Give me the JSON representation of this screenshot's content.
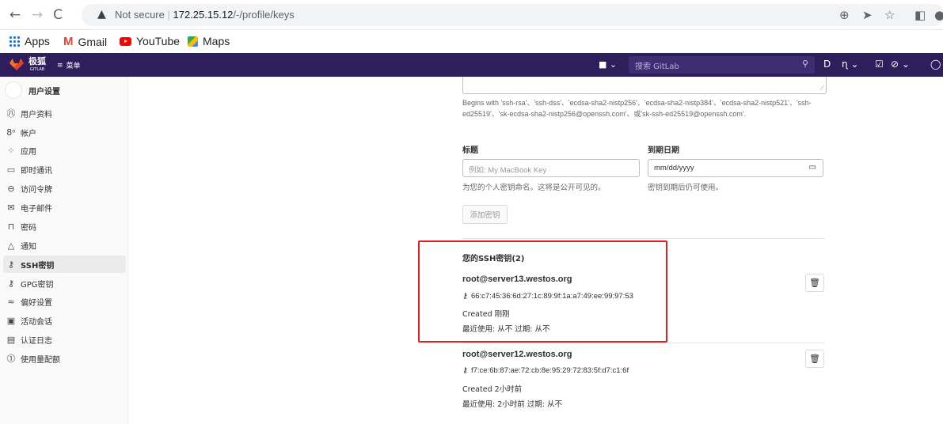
{
  "browser": {
    "warning": "Not secure",
    "url_host": "172.25.15.12",
    "url_path": "/-/profile/keys"
  },
  "bookmarks": [
    {
      "label": "Apps",
      "icon": "apps-grid-icon"
    },
    {
      "label": "Gmail",
      "icon": "gmail-icon"
    },
    {
      "label": "YouTube",
      "icon": "youtube-icon"
    },
    {
      "label": "Maps",
      "icon": "maps-icon"
    }
  ],
  "gitlab": {
    "brand": "极狐",
    "brand_sub": "GITLAB",
    "menu": "菜单",
    "search_placeholder": "搜索 GitLab"
  },
  "sidebar": {
    "title": "用户设置",
    "items": [
      {
        "label": "用户资料",
        "icon": "profile-icon"
      },
      {
        "label": "帐户",
        "icon": "account-icon"
      },
      {
        "label": "应用",
        "icon": "applications-icon"
      },
      {
        "label": "即时通讯",
        "icon": "chat-icon"
      },
      {
        "label": "访问令牌",
        "icon": "token-icon"
      },
      {
        "label": "电子邮件",
        "icon": "email-icon"
      },
      {
        "label": "密码",
        "icon": "lock-icon"
      },
      {
        "label": "通知",
        "icon": "bell-icon"
      },
      {
        "label": "SSH密钥",
        "icon": "key-icon",
        "active": true
      },
      {
        "label": "GPG密钥",
        "icon": "key-icon"
      },
      {
        "label": "偏好设置",
        "icon": "preferences-icon"
      },
      {
        "label": "活动会话",
        "icon": "sessions-icon"
      },
      {
        "label": "认证日志",
        "icon": "log-icon"
      },
      {
        "label": "使用量配额",
        "icon": "quota-icon"
      }
    ]
  },
  "form": {
    "key_help": "Begins with 'ssh-rsa'、'ssh-dss'、'ecdsa-sha2-nistp256'、'ecdsa-sha2-nistp384'、'ecdsa-sha2-nistp521'、'ssh-ed25519'、'sk-ecdsa-sha2-nistp256@openssh.com'、或'sk-ssh-ed25519@openssh.com'.",
    "title_label": "标题",
    "title_placeholder": "例如: My MacBook Key",
    "title_help": "为您的个人密钥命名。这将是公开可见的。",
    "expiry_label": "到期日期",
    "expiry_value": "mm/dd/yyyy",
    "expiry_help": "密钥到期后仍可使用。",
    "add_button": "添加密钥"
  },
  "keys_section": {
    "title": "您的SSH密钥(2)",
    "keys": [
      {
        "name": "root@server13.westos.org",
        "fingerprint": "66:c7:45:36:6d:27:1c:89:9f:1a:a7:49:ee:99:97:53",
        "created": "Created 刚刚",
        "usage": "最近使用: 从不  过期: 从不"
      },
      {
        "name": "root@server12.westos.org",
        "fingerprint": "f7:ce:6b:87:ae:72:cb:8e:95:29:72:83:5f:d7:c1:6f",
        "created": "Created 2小时前",
        "usage": "最近使用: 2小时前  过期: 从不"
      }
    ]
  },
  "colors": {
    "gitlab_topbar": "#2f1e5c",
    "highlight_border": "#e02020"
  }
}
